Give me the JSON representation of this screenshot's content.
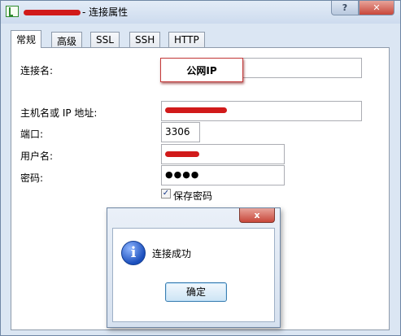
{
  "window": {
    "title": "- 连接属性"
  },
  "tabs": [
    {
      "label": "常规"
    },
    {
      "label": "高级"
    },
    {
      "label": "SSL"
    },
    {
      "label": "SSH"
    },
    {
      "label": "HTTP"
    }
  ],
  "general": {
    "connection_name_label": "连接名:",
    "connection_name_value": "公网IP",
    "host_label": "主机名或 IP 地址:",
    "port_label": "端口:",
    "port_value": "3306",
    "user_label": "用户名:",
    "password_label": "密码:",
    "password_value": "●●●●",
    "save_password_label": "保存密码",
    "save_password_checked": true
  },
  "dialog": {
    "close_glyph": "x",
    "message": "连接成功",
    "ok_label": "确定",
    "icon": "info-icon"
  },
  "colors": {
    "redaction": "#d11a1a",
    "window_frame": "#dbe6f3",
    "close_button": "#c8473a"
  }
}
